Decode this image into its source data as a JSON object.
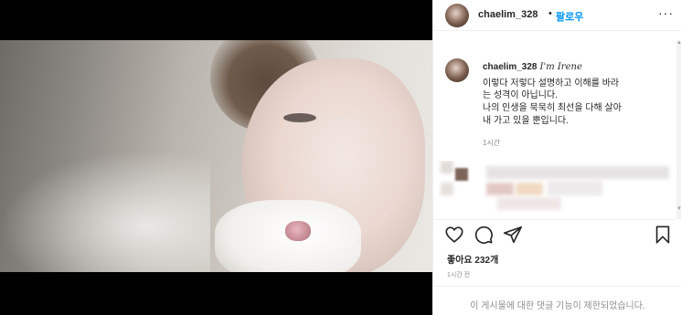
{
  "post": {
    "header": {
      "username": "chaelim_328",
      "separator": "•",
      "follow_label": "팔로우",
      "more_icon": "more-options-icon",
      "more_label": "···"
    },
    "caption": {
      "username": "chaelim_328",
      "tag": "I'm Irene",
      "lines": [
        "이렇다 저렇다 설명하고 이해를 바라",
        "는 성격이 아닙니다.",
        "나의 인생을 묵묵히 최선을 다해 살아",
        "내 가고 있을 뿐입니다."
      ],
      "time": "1시간"
    },
    "actions": {
      "like_icon": "heart-icon",
      "comment_icon": "comment-icon",
      "share_icon": "share-icon",
      "save_icon": "bookmark-icon"
    },
    "likes_text": "좋아요 232개",
    "posted_ago": "1시간 전",
    "comments_restricted": "이 게시물에 대한 댓글 기능이 제한되었습니다.",
    "colors": {
      "follow_blue": "#0095f6",
      "text": "#262626",
      "muted": "#8e8e8e",
      "border": "#efefef"
    }
  }
}
